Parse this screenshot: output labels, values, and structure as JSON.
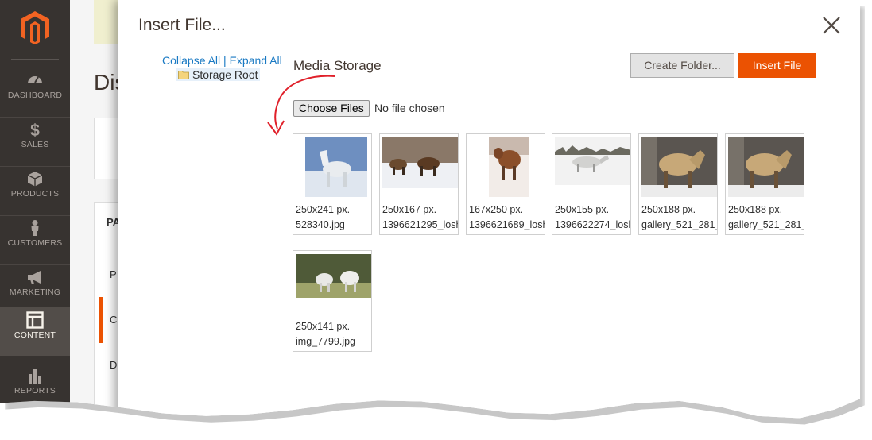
{
  "sidebar": {
    "logo": "magento-logo",
    "items": [
      {
        "label": "DASHBOARD",
        "icon": "speedometer-icon"
      },
      {
        "label": "SALES",
        "icon": "dollar-icon"
      },
      {
        "label": "PRODUCTS",
        "icon": "cube-icon"
      },
      {
        "label": "CUSTOMERS",
        "icon": "person-icon"
      },
      {
        "label": "MARKETING",
        "icon": "megaphone-icon"
      },
      {
        "label": "CONTENT",
        "icon": "layout-icon",
        "active": true
      },
      {
        "label": "REPORTS",
        "icon": "bar-chart-icon"
      }
    ]
  },
  "background_page": {
    "title_fragment": "Dis",
    "panel_header_fragment": "PA",
    "row1_fragment": "P",
    "row2_fragment": "C",
    "row3_fragment": "D"
  },
  "modal": {
    "title": "Insert File...",
    "tree": {
      "collapse_all": "Collapse All",
      "separator": "|",
      "expand_all": "Expand All",
      "root": "Storage Root"
    },
    "storage_title": "Media Storage",
    "create_folder": "Create Folder...",
    "insert_file": "Insert File",
    "choose_files": "Choose Files",
    "no_file": "No file chosen",
    "files": [
      {
        "dim": "250x241 px.",
        "name": "528340.jpg"
      },
      {
        "dim": "250x167 px.",
        "name": "1396621295_losh"
      },
      {
        "dim": "167x250 px.",
        "name": "1396621689_losh"
      },
      {
        "dim": "250x155 px.",
        "name": "1396622274_losh"
      },
      {
        "dim": "250x188 px.",
        "name": "gallery_521_281_"
      },
      {
        "dim": "250x188 px.",
        "name": "gallery_521_281_"
      },
      {
        "dim": "250x141 px.",
        "name": "img_7799.jpg"
      }
    ]
  },
  "colors": {
    "accent": "#eb5202",
    "sidebar": "#373330",
    "link": "#1979c3",
    "annotation_arrow": "#e0202a"
  }
}
